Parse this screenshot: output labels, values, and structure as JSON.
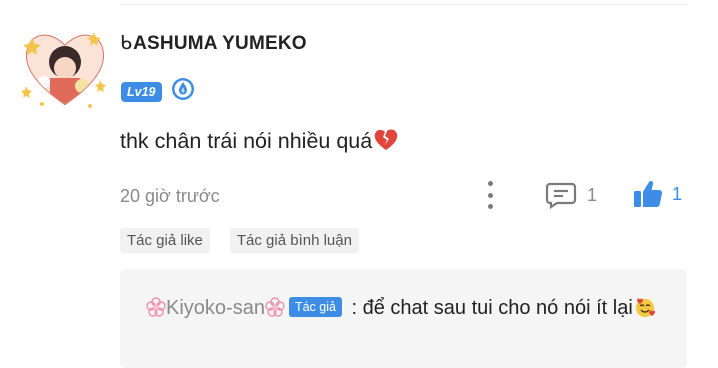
{
  "comment": {
    "user": {
      "name_prefix": "ᑲ",
      "name": "ASHUMA YUMEKO",
      "level": "Lv19"
    },
    "text": "thk chân trái nói nhiều quá",
    "time": "20 giờ trước",
    "reply_count": "1",
    "like_count": "1",
    "tags": [
      "Tác giả like",
      "Tác giả bình luận"
    ]
  },
  "reply": {
    "author": "Kiyoko-san",
    "author_badge": "Tác giả",
    "separator": " : ",
    "text": "để chat sau tui cho nó nói ít lại"
  },
  "colors": {
    "accent": "#3d8de6",
    "muted_text": "#8a8a8a",
    "tag_bg": "#f1f1f1",
    "reply_bg": "#f5f5f5",
    "heart": "#e0453a"
  },
  "icons": {
    "level_badge": "drop-icon",
    "comment_emoji": "broken-heart-icon",
    "reply_emoji": "smiling-face-with-hearts-icon",
    "more": "more-vertical-icon",
    "reply": "comment-icon",
    "like": "thumbs-up-icon",
    "author_decoration": "flower-icon"
  }
}
